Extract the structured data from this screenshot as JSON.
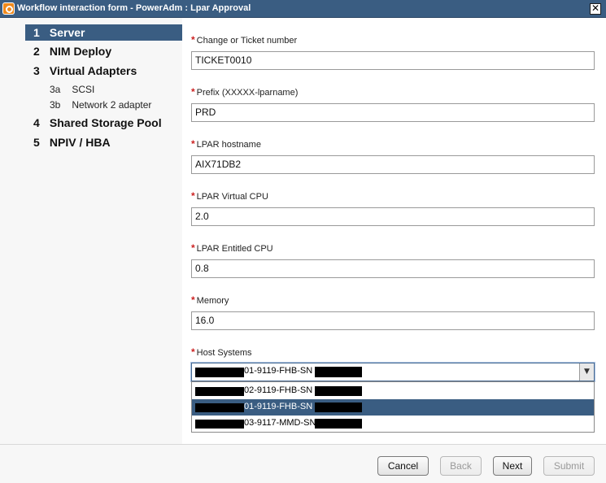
{
  "window": {
    "title": "Workflow interaction form - PowerAdm : Lpar Approval",
    "close_glyph": "✕"
  },
  "sidebar": {
    "items": [
      {
        "num": "1",
        "label": "Server",
        "active": true
      },
      {
        "num": "2",
        "label": "NIM Deploy",
        "active": false
      },
      {
        "num": "3",
        "label": "Virtual Adapters",
        "active": false
      },
      {
        "num": "4",
        "label": "Shared Storage Pool",
        "active": false
      },
      {
        "num": "5",
        "label": "NPIV / HBA",
        "active": false
      }
    ],
    "subitems": [
      {
        "num": "3a",
        "label": "SCSI"
      },
      {
        "num": "3b",
        "label": "Network 2 adapter"
      }
    ]
  },
  "form": {
    "required_marker": "*",
    "fields": [
      {
        "label": "Change or Ticket number",
        "value": "TICKET0010"
      },
      {
        "label": "Prefix (XXXXX-lparname)",
        "value": "PRD"
      },
      {
        "label": "LPAR hostname",
        "value": "AIX71DB2"
      },
      {
        "label": "LPAR Virtual CPU",
        "value": "2.0"
      },
      {
        "label": "LPAR Entitled CPU",
        "value": "0.8"
      },
      {
        "label": "Memory",
        "value": "16.0"
      }
    ],
    "host_systems": {
      "label": "Host Systems",
      "selected": "01-9119-FHB-SN",
      "options": [
        {
          "text": "02-9119-FHB-SN",
          "selected": false
        },
        {
          "text": "01-9119-FHB-SN",
          "selected": true
        },
        {
          "text": "03-9117-MMD-SN",
          "selected": false
        }
      ]
    }
  },
  "footer": {
    "cancel": "Cancel",
    "back": "Back",
    "next": "Next",
    "submit": "Submit"
  },
  "colors": {
    "accent": "#3a5d82",
    "required": "#cc2222"
  }
}
